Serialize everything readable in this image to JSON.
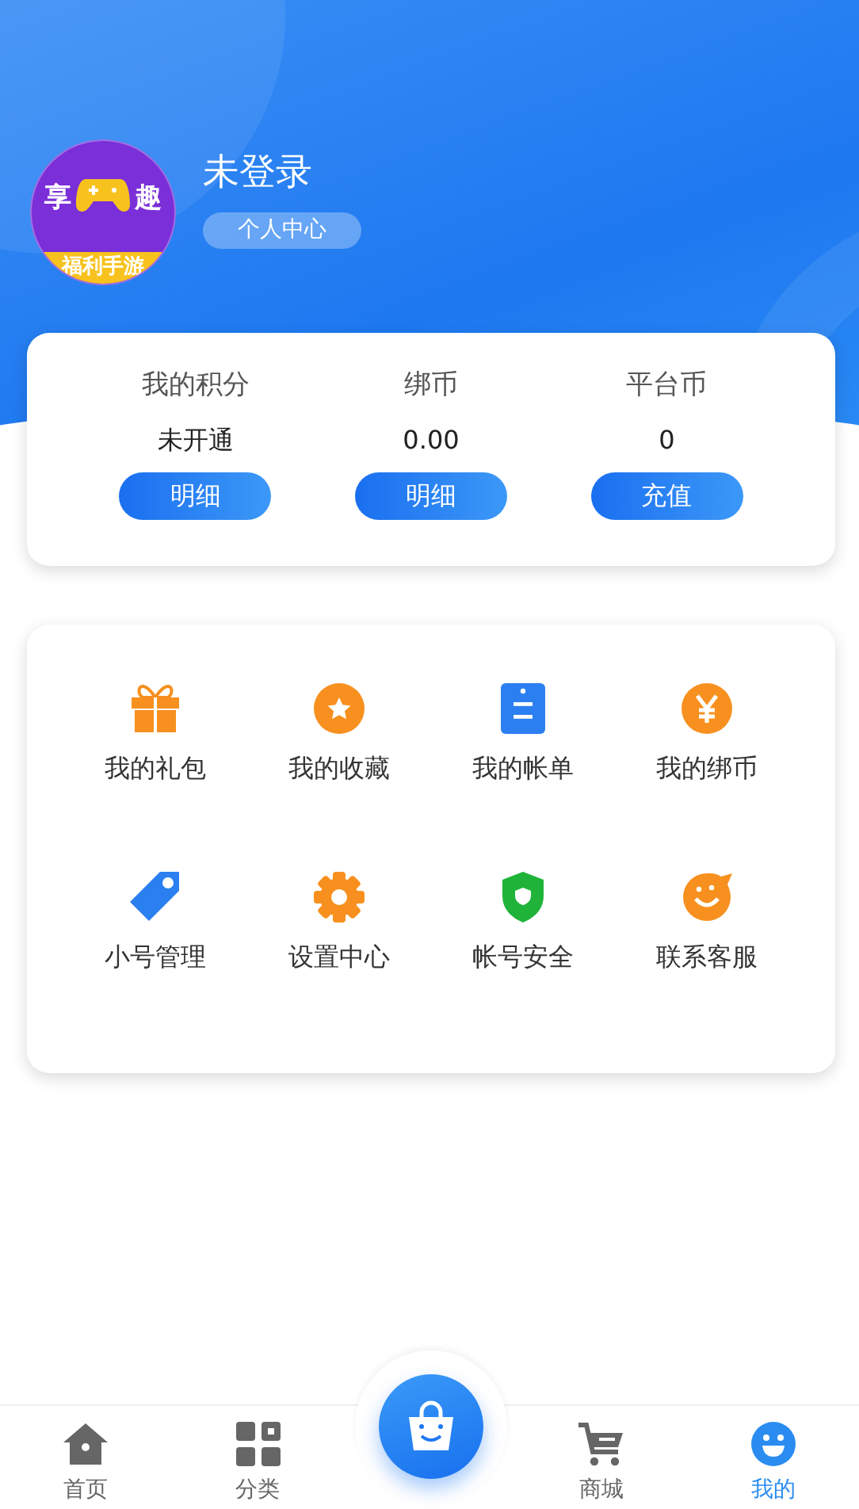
{
  "avatar": {
    "left_char": "享",
    "right_char": "趣",
    "banner": "福利手游"
  },
  "user": {
    "name": "未登录",
    "badge": "个人中心"
  },
  "stats": [
    {
      "label": "我的积分",
      "value": "未开通",
      "button": "明细"
    },
    {
      "label": "绑币",
      "value": "0.00",
      "button": "明细"
    },
    {
      "label": "平台币",
      "value": "0",
      "button": "充值"
    }
  ],
  "menu": [
    {
      "label": "我的礼包"
    },
    {
      "label": "我的收藏"
    },
    {
      "label": "我的帐单"
    },
    {
      "label": "我的绑币"
    },
    {
      "label": "小号管理"
    },
    {
      "label": "设置中心"
    },
    {
      "label": "帐号安全"
    },
    {
      "label": "联系客服"
    }
  ],
  "nav": [
    {
      "label": "首页",
      "selected": false
    },
    {
      "label": "分类",
      "selected": false
    },
    {
      "label": "商城",
      "selected": false
    },
    {
      "label": "我的",
      "selected": true
    }
  ]
}
